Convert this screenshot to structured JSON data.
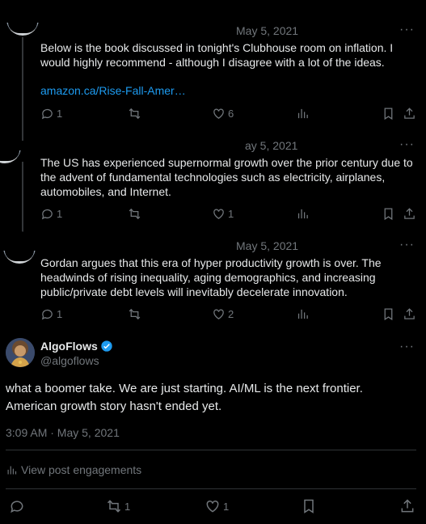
{
  "thread": [
    {
      "date": "May 5, 2021",
      "text": "Below is the book discussed in tonight's Clubhouse room on inflation. I would highly recommend - although I disagree with a lot of the ideas.",
      "link": "amazon.ca/Rise-Fall-Amer…",
      "replies": "1",
      "retweets": "",
      "likes": "6"
    },
    {
      "date": "ay 5, 2021",
      "text": "The US has experienced supernormal growth over the prior century due to the advent of fundamental technologies such as electricity, airplanes, automobiles, and Internet.",
      "replies": "1",
      "retweets": "",
      "likes": "1"
    },
    {
      "date": "May 5, 2021",
      "text": "Gordan argues that this era of hyper productivity growth is over. The headwinds of rising inequality, aging demographics, and increasing public/private debt levels will inevitably decelerate innovation.",
      "replies": "1",
      "retweets": "",
      "likes": "2"
    }
  ],
  "main_post": {
    "name": "AlgoFlows",
    "handle": "@algoflows",
    "text": "what a boomer take. We are just starting. AI/ML is the next frontier. American growth story hasn't ended yet.",
    "timestamp": "3:09 AM · May 5, 2021",
    "engagements_label": "View post engagements",
    "retweets": "1",
    "likes": "1"
  },
  "more_label": "···",
  "colors": {
    "background": "#000000",
    "text": "#e7e9ea",
    "muted": "#71767b",
    "link": "#1d9bf0",
    "verified": "#1d9bf0"
  }
}
